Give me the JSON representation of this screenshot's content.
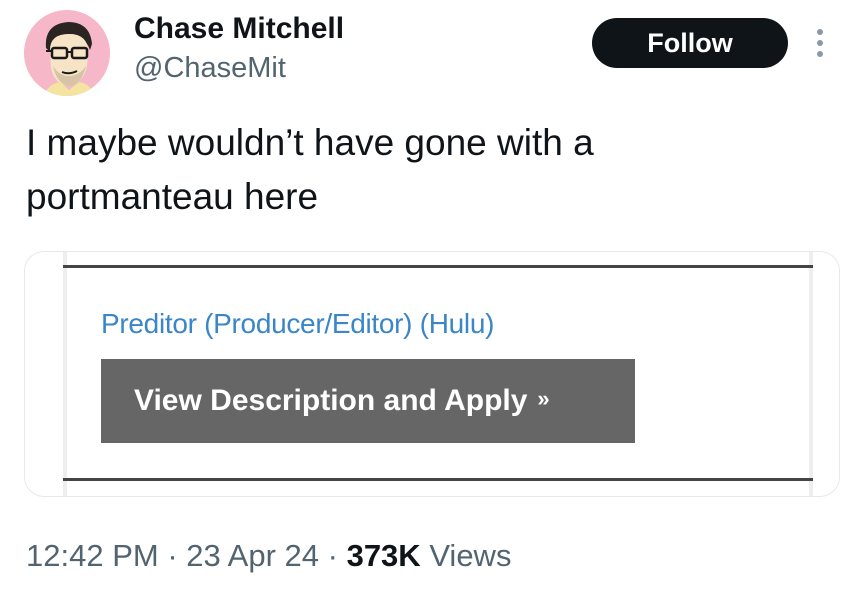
{
  "user": {
    "name": "Chase Mitchell",
    "handle": "@ChaseMit"
  },
  "follow_label": "Follow",
  "tweet": {
    "line1": "I maybe wouldn’t have gone with a",
    "line2": "portmanteau here"
  },
  "card": {
    "job_title": "Preditor (Producer/Editor) (Hulu)",
    "button_label": "View Description and Apply",
    "button_chevron": "»"
  },
  "meta": {
    "time": "12:42 PM",
    "sep1": "·",
    "date": "23 Apr 24",
    "sep2": "·",
    "views_count": "373K",
    "views_label": "Views"
  },
  "colors": {
    "follow_bg": "#0f1419",
    "link": "#3a86c8",
    "apply_bg": "#666666",
    "avatar_bg": "#f6b8c8",
    "secondary_text": "#536471"
  },
  "icons": {
    "avatar": "avatar-illustration",
    "more": "more-vertical-icon"
  }
}
